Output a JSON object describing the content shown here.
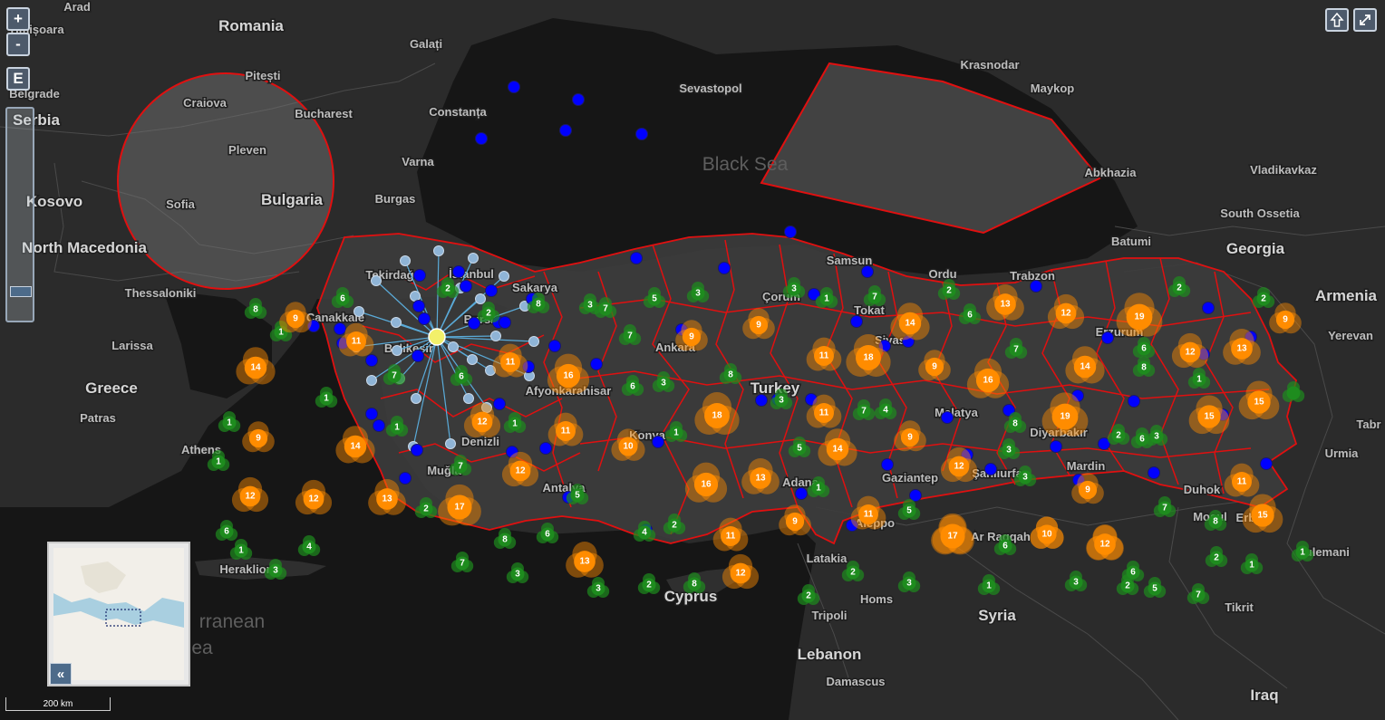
{
  "labels": {
    "countries": [
      {
        "name": "Romania"
      },
      {
        "name": "Bulgaria"
      },
      {
        "name": "Serbia"
      },
      {
        "name": "Kosovo"
      },
      {
        "name": "North Macedonia"
      },
      {
        "name": "Greece"
      },
      {
        "name": "Turkey"
      },
      {
        "name": "Georgia"
      },
      {
        "name": "Syria"
      },
      {
        "name": "Cyprus"
      },
      {
        "name": "Lebanon"
      },
      {
        "name": "Iraq"
      },
      {
        "name": "Armenia"
      }
    ],
    "cities": [
      {
        "name": "Arad"
      },
      {
        "name": "Timișoara"
      },
      {
        "name": "Galați"
      },
      {
        "name": "Pitești"
      },
      {
        "name": "Craiova"
      },
      {
        "name": "Bucharest"
      },
      {
        "name": "Constanța"
      },
      {
        "name": "Pleven"
      },
      {
        "name": "Sofia"
      },
      {
        "name": "Varna"
      },
      {
        "name": "Burgas"
      },
      {
        "name": "Belgrade"
      },
      {
        "name": "Thessaloniki"
      },
      {
        "name": "Larissa"
      },
      {
        "name": "Patras"
      },
      {
        "name": "Athens"
      },
      {
        "name": "Heraklion"
      },
      {
        "name": "Sevastopol"
      },
      {
        "name": "Krasnodar"
      },
      {
        "name": "Maykop"
      },
      {
        "name": "Abkhazia"
      },
      {
        "name": "Vladikavkaz"
      },
      {
        "name": "South Ossetia"
      },
      {
        "name": "Batumi"
      },
      {
        "name": "Samsun"
      },
      {
        "name": "Trabzon"
      },
      {
        "name": "Ordu"
      },
      {
        "name": "Çorum"
      },
      {
        "name": "Tokat"
      },
      {
        "name": "Sivas"
      },
      {
        "name": "Erzurum"
      },
      {
        "name": "Yerevan"
      },
      {
        "name": "Ankara"
      },
      {
        "name": "Sakarya"
      },
      {
        "name": "Tekirdağ"
      },
      {
        "name": "İstanbul"
      },
      {
        "name": "Çanakkale"
      },
      {
        "name": "Balıkesir"
      },
      {
        "name": "Bursa"
      },
      {
        "name": "Afyonkarahisar"
      },
      {
        "name": "Denizli"
      },
      {
        "name": "Muğla"
      },
      {
        "name": "Antalya"
      },
      {
        "name": "Konya"
      },
      {
        "name": "Adana"
      },
      {
        "name": "Gaziantep"
      },
      {
        "name": "Şanlıurfa"
      },
      {
        "name": "Malatya"
      },
      {
        "name": "Diyarbakır"
      },
      {
        "name": "Mardin"
      },
      {
        "name": "Duhok"
      },
      {
        "name": "Mosul"
      },
      {
        "name": "Urmia"
      },
      {
        "name": "Tabr"
      },
      {
        "name": "Aleppo"
      },
      {
        "name": "Ar Raqqah"
      },
      {
        "name": "Latakia"
      },
      {
        "name": "Homs"
      },
      {
        "name": "Tripoli"
      },
      {
        "name": "Damascus"
      },
      {
        "name": "Tikrit"
      },
      {
        "name": "Erbil"
      },
      {
        "name": "Sulemani"
      }
    ],
    "sea": [
      {
        "name": "Black Sea"
      },
      {
        "name": "rranean"
      },
      {
        "name": "ea"
      }
    ]
  },
  "controls": {
    "zoom_in": "+",
    "zoom_out": "-",
    "extent": "E",
    "home_icon": "up-arrow-icon",
    "fullscreen_icon": "expand-icon",
    "overview_toggle": "«"
  },
  "scale": {
    "label": "200 km"
  },
  "colors": {
    "orange_cluster": "#ff8c00",
    "green_cluster": "#1e8c1e",
    "blue_point": "#0000ff",
    "boundary": "#e01010",
    "spider_line": "#5aaad8",
    "spider_point": "#8fb4d6",
    "spider_center": "#f2f06a"
  },
  "clusters": {
    "orange": [
      9,
      11,
      14,
      9,
      14,
      12,
      12,
      13,
      17,
      12,
      11,
      12,
      9,
      11,
      16,
      10,
      16,
      18,
      11,
      9,
      13,
      14,
      11,
      18,
      14,
      9,
      13,
      12,
      16,
      9,
      9,
      12,
      11,
      15,
      13,
      19,
      10,
      19,
      12,
      14,
      13,
      15,
      15,
      11,
      15,
      17,
      10,
      12,
      9,
      11,
      12,
      13
    ],
    "green": [
      6,
      8,
      1,
      1,
      1,
      1,
      1,
      1,
      6,
      7,
      2,
      1,
      6,
      8,
      2,
      7,
      2,
      8,
      5,
      6,
      7,
      4,
      3,
      3,
      3,
      2,
      8,
      2,
      4,
      6,
      3,
      1,
      8,
      3,
      5,
      1,
      2,
      5,
      2,
      3,
      6,
      1,
      3,
      6,
      2,
      5,
      7,
      7,
      8,
      2,
      1,
      1,
      2,
      6,
      3,
      3,
      3,
      8,
      7,
      6,
      2,
      7,
      1,
      3,
      3,
      5,
      7,
      3,
      7,
      7,
      4,
      6,
      8,
      1,
      2,
      2
    ]
  }
}
